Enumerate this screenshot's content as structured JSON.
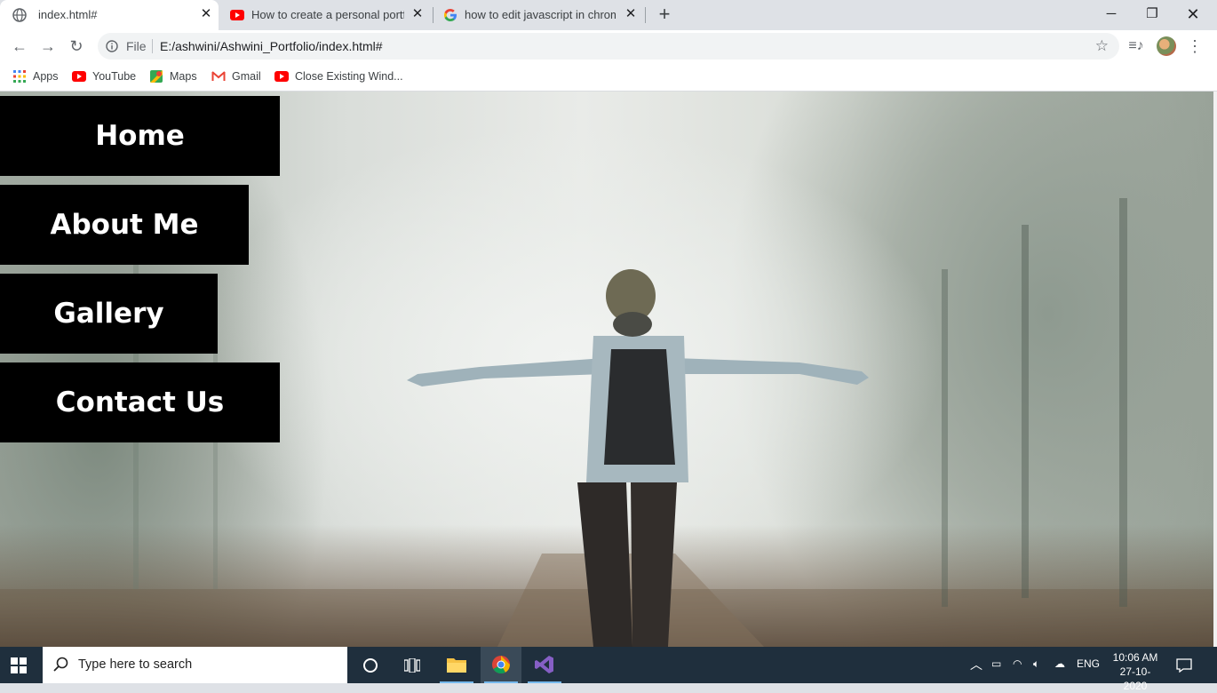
{
  "browser": {
    "tabs": [
      {
        "title": "index.html#",
        "favicon": "globe-icon",
        "active": true
      },
      {
        "title": "How to create a personal portfoli",
        "favicon": "youtube-icon",
        "active": false
      },
      {
        "title": "how to edit javascript in chrome",
        "favicon": "google-icon",
        "active": false
      }
    ],
    "address": {
      "scheme_label": "File",
      "url": "E:/ashwini/Ashwini_Portfolio/index.html#"
    },
    "bookmarks": [
      {
        "label": "Apps",
        "icon": "apps-grid-icon"
      },
      {
        "label": "YouTube",
        "icon": "youtube-icon"
      },
      {
        "label": "Maps",
        "icon": "maps-icon"
      },
      {
        "label": "Gmail",
        "icon": "gmail-icon"
      },
      {
        "label": "Close Existing Wind...",
        "icon": "youtube-icon"
      }
    ]
  },
  "page": {
    "menu": [
      {
        "label": "Home"
      },
      {
        "label": "About Me"
      },
      {
        "label": "Gallery"
      },
      {
        "label": "Contact Us"
      }
    ]
  },
  "taskbar": {
    "search_placeholder": "Type here to search",
    "language": "ENG",
    "time": "10:06 AM",
    "date": "27-10-2020"
  },
  "colors": {
    "menu_bg": "#000000",
    "menu_text": "#ffffff",
    "taskbar_bg": "#1f2f3d",
    "chrome_frame": "#dee1e6"
  }
}
